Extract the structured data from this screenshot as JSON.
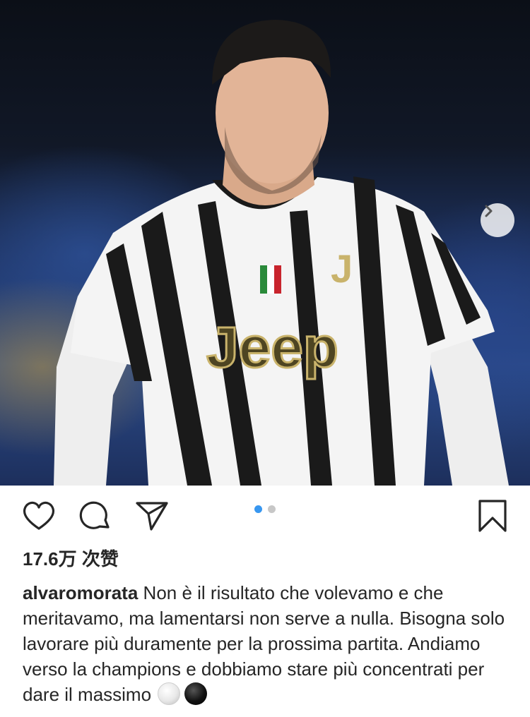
{
  "post": {
    "photo_alt": "",
    "carousel": {
      "count": 2,
      "active_index": 0
    },
    "colors": {
      "active_dot": "#3897f0",
      "inactive_dot": "#c7c7c7",
      "text": "#262626"
    },
    "likes_text": "17.6万 次赞",
    "caption": {
      "username": "alvaromorata",
      "text": "Non è il risultato che volevamo e che meritavamo, ma lamentarsi non serve a nulla. Bisogna solo lavorare più duramente per la prossima partita. Andiamo verso la champions e dobbiamo stare più concentrati per dare il massimo",
      "emojis": [
        "white-circle-emoji",
        "black-circle-emoji"
      ]
    },
    "shirt": {
      "brand": "Jeep"
    }
  },
  "icons": {
    "like": "heart-icon",
    "comment": "comment-bubble-icon",
    "share": "paper-plane-icon",
    "save": "bookmark-icon",
    "next": "chevron-right-icon"
  }
}
